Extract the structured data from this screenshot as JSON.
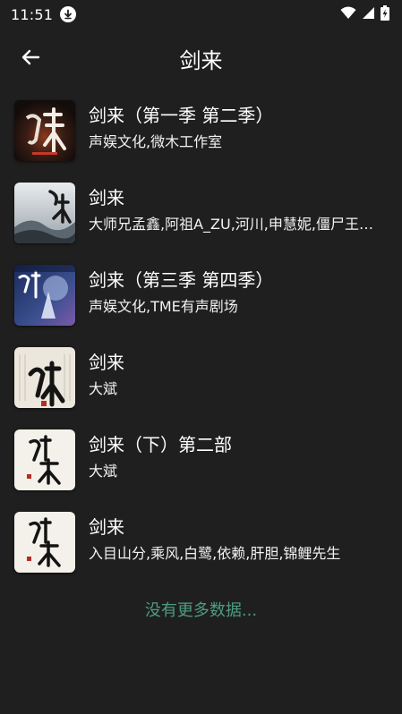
{
  "status_bar": {
    "time": "11:51",
    "icons": [
      "download-icon",
      "wifi-icon",
      "signal-icon",
      "battery-charging-icon"
    ]
  },
  "header": {
    "back_icon": "arrow-left-icon",
    "title": "剑来"
  },
  "results": [
    {
      "title": "剑来（第一季 第二季）",
      "artist": "声娱文化,微木工作室",
      "cover_icon": "cover-art-1"
    },
    {
      "title": "剑来",
      "artist": "大师兄孟鑫,阿祖A_ZU,河川,申慧妮,僵尸王Ace,小九",
      "cover_icon": "cover-art-2"
    },
    {
      "title": "剑来（第三季 第四季）",
      "artist": "声娱文化,TME有声剧场",
      "cover_icon": "cover-art-3"
    },
    {
      "title": "剑来",
      "artist": "大斌",
      "cover_icon": "cover-art-4"
    },
    {
      "title": "剑来（下）第二部",
      "artist": "大斌",
      "cover_icon": "cover-art-5"
    },
    {
      "title": "剑来",
      "artist": "入目山分,乘风,白鹭,依赖,肝胆,锦鲤先生",
      "cover_icon": "cover-art-6"
    }
  ],
  "footer": {
    "no_more_text": "没有更多数据...",
    "no_more_color": "#4f9a83"
  },
  "colors": {
    "background": "#1f1f1f",
    "text": "#ffffff"
  }
}
